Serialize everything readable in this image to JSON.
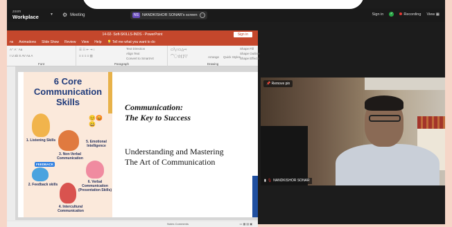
{
  "zoom": {
    "logo_small": "zoom",
    "logo_big": "Workplace",
    "meeting_label": "Meeting",
    "share_initials": "NS",
    "share_label": "NANDKISHOR SONAR's screen",
    "sign_in": "Sign in",
    "recording_label": "Recording",
    "view_label": "View"
  },
  "ppt": {
    "title": "14-02- Soft-SKILLS-INDS  -  PowerPoint",
    "sign_in": "Sign in",
    "tabs": [
      "ns",
      "Animations",
      "Slide Show",
      "Review",
      "View",
      "Help",
      "Tell me what you want to do"
    ],
    "ribbon": {
      "font_label": "Font",
      "paragraph_label": "Paragraph",
      "drawing_label": "Drawing",
      "text_direction": "Text Direction",
      "align_text": "Align Text",
      "convert_smartart": "Convert to SmartArt",
      "arrange": "Arrange",
      "quick_styles": "Quick Styles",
      "shape_fill": "Shape Fill",
      "shape_outline": "Shape Outline",
      "shape_effects": "Shape Effects"
    },
    "slide": {
      "infographic_title": "6 Core Communication Skills",
      "items": [
        "1. Listening Skills",
        "5. Emotional Intelligence",
        "3. Non-Verbal Communication",
        "2. Feedback skills",
        "6. Verbal Communication (Presentation Skills)",
        "4. Intercultural Communication"
      ],
      "feedback_tag": "FEEDBACK",
      "heading_line1": "Communication:",
      "heading_line2": "The Key to Success",
      "sub_line1": "Understanding and Mastering",
      "sub_line2": "The Art of Communication"
    },
    "status": {
      "notes": "Notes",
      "comments": "Comments"
    }
  },
  "video": {
    "remove_pin": "Remove pin",
    "participant": "NANDKISHOR SONAR"
  },
  "colors": {
    "ppt_accent": "#c4472c",
    "zoom_bg": "#1a1a1a",
    "recording": "#e53935",
    "frame": "#f6d6c8"
  }
}
